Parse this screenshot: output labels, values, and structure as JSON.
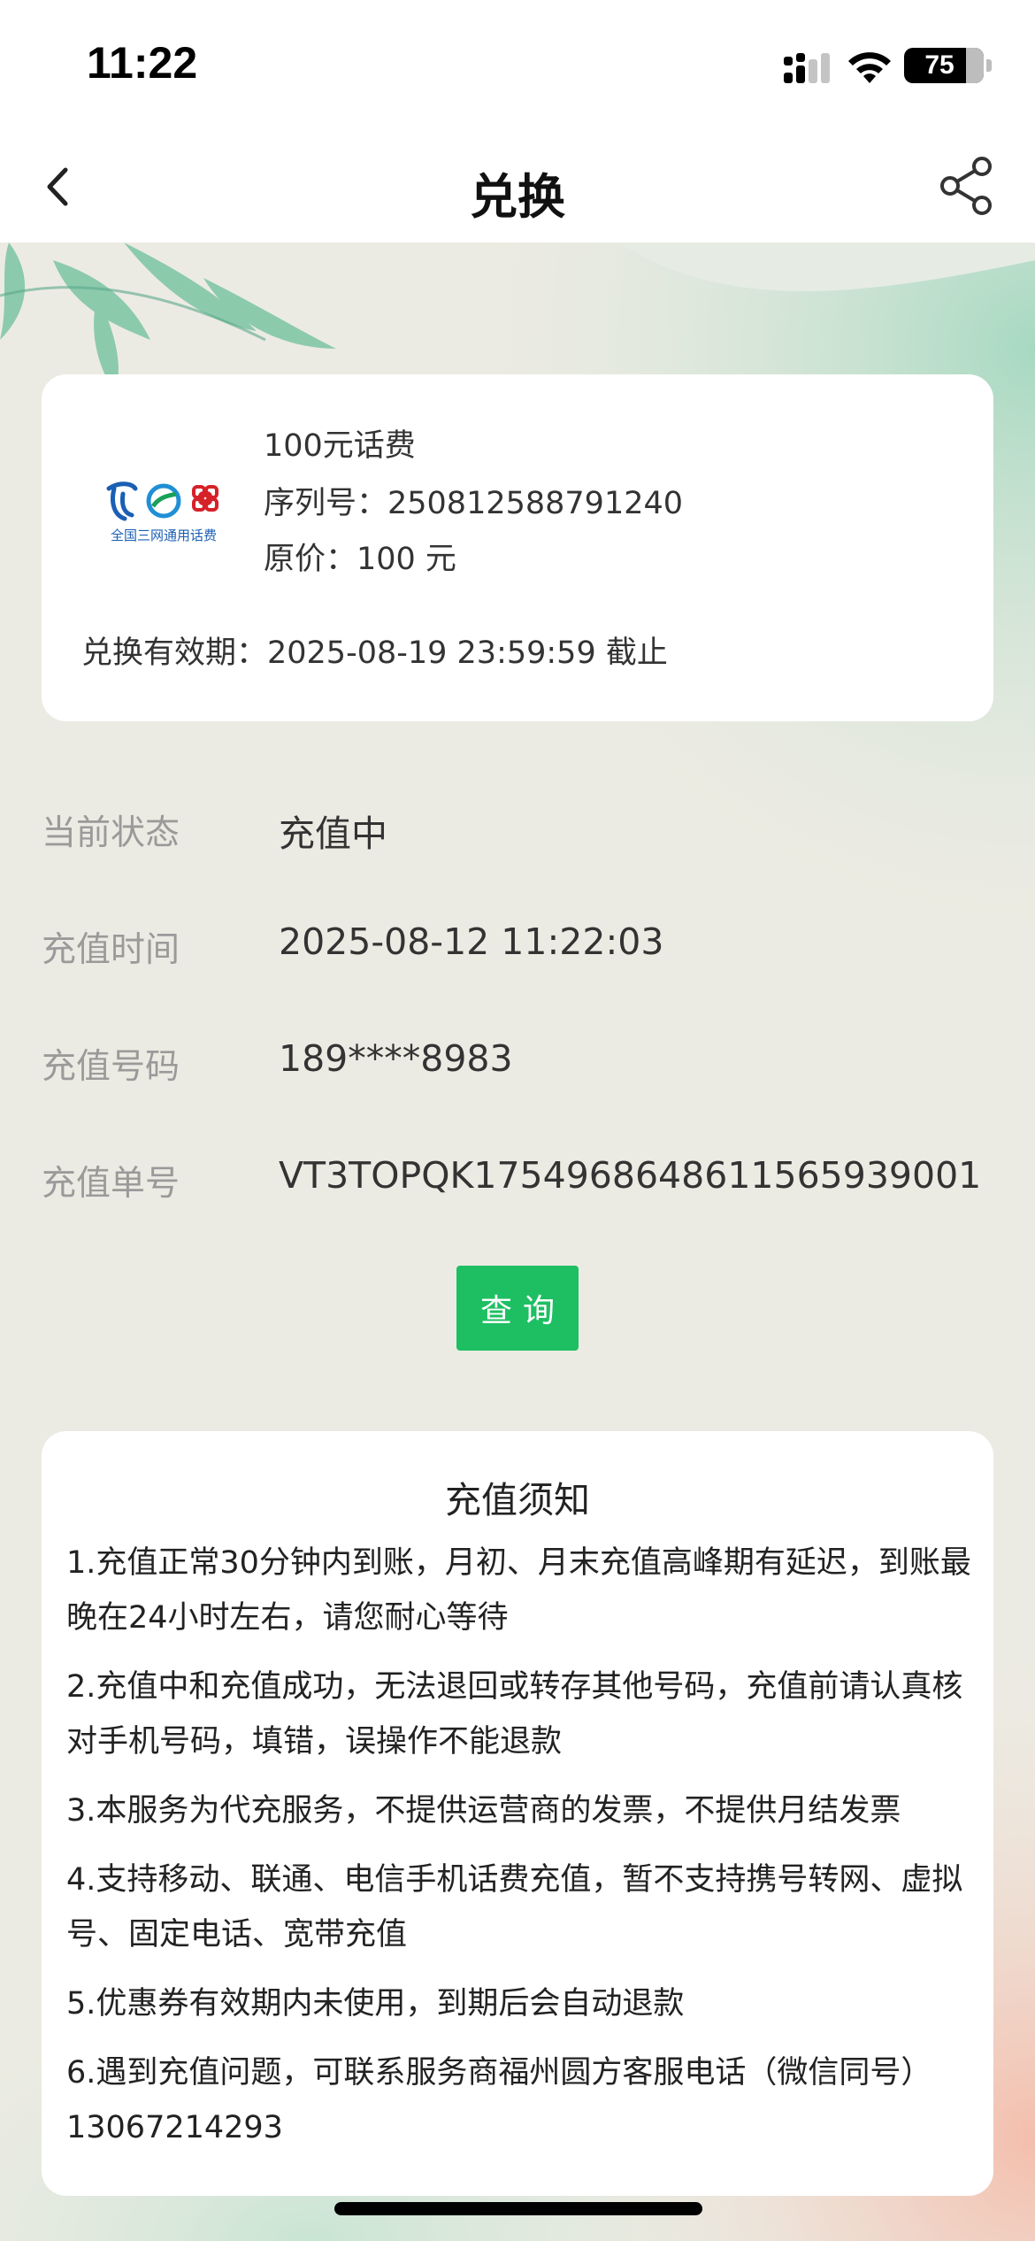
{
  "status_bar": {
    "time": "11:22",
    "battery": "75",
    "icons": [
      "signal-icon",
      "wifi-icon",
      "battery-icon"
    ]
  },
  "nav": {
    "title": "兑换",
    "back_icon": "chevron-left-icon",
    "share_icon": "share-icon"
  },
  "product": {
    "logo_text": "全国三网通用话费",
    "name": "100元话费",
    "serial": "序列号：250812588791240",
    "price": "原价：100 元",
    "validity": "兑换有效期：2025-08-19 23:59:59 截止"
  },
  "details": {
    "status_label": "当前状态",
    "status_value": "充值中",
    "time_label": "充值时间",
    "time_value": "2025-08-12 11:22:03",
    "phone_label": "充值号码",
    "phone_value": "189****8983",
    "order_label": "充值单号",
    "order_value": "VT3TOPQK17549686486115659390​01"
  },
  "query_button": "查询",
  "notice": {
    "title": "充值须知",
    "items": [
      "1.充值正常30分钟内到账，月初、月末充值高峰期有延迟，到账最晚在24小时左右，请您耐心等待",
      "2.充值中和充值成功，无法退回或转存其他号码，充值前请认真核对手机号码，填错，误操作不能退款",
      "3.本服务为代充服务，不提供运营商的发票，不提供月结发票",
      "4.支持移动、联通、电信手机话费充值，暂不支持携号转网、虚拟号、固定电话、宽带充值",
      "5.优惠券有效期内未使用，到期后会自动退款",
      "6.遇到充值问题，可联系服务商福州圆方客服电话（微信同号）13067214293"
    ]
  },
  "colors": {
    "accent_green": "#1dbf62",
    "background": "#ecebe3",
    "label_gray": "#9a9a9a"
  }
}
